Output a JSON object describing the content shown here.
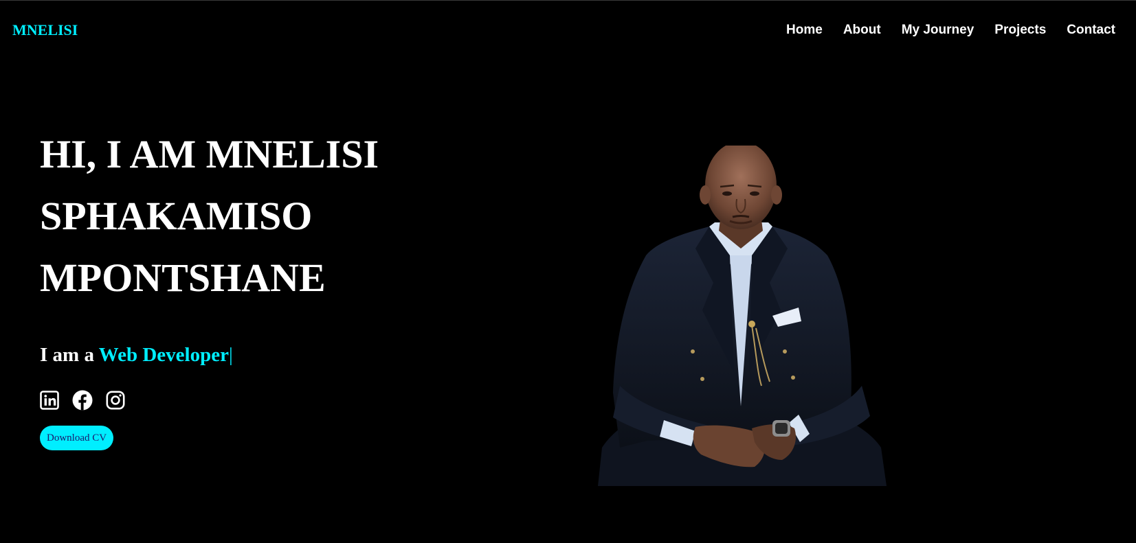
{
  "brand": {
    "logo_text": "MNELISI",
    "accent_color": "#00eeff"
  },
  "nav": {
    "items": [
      {
        "label": "Home"
      },
      {
        "label": "About"
      },
      {
        "label": "My Journey"
      },
      {
        "label": "Projects"
      },
      {
        "label": "Contact"
      }
    ]
  },
  "hero": {
    "title_lines": [
      "HI, I AM MNELISI",
      "SPHAKAMISO",
      "MPONTSHANE"
    ],
    "subtitle_prefix": "I am a ",
    "subtitle_role": "Web Developer",
    "typing_cursor": "|",
    "socials": [
      {
        "icon": "linkedin-icon"
      },
      {
        "icon": "facebook-icon"
      },
      {
        "icon": "instagram-icon"
      }
    ],
    "cta_label": "Download CV"
  }
}
